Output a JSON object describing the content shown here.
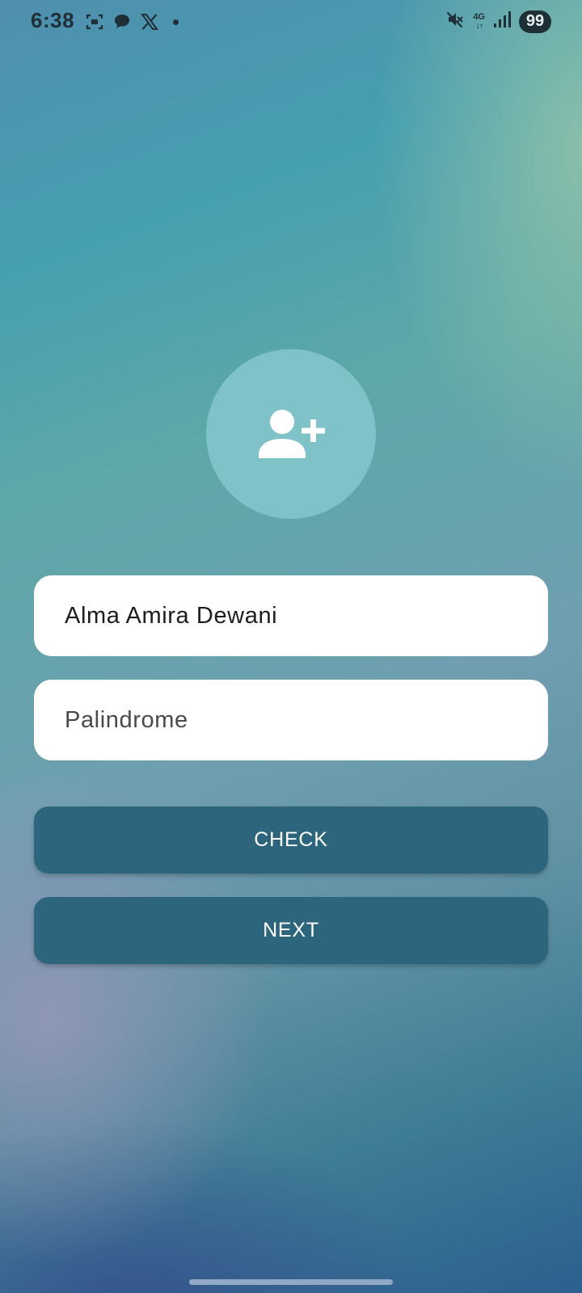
{
  "status_bar": {
    "time": "6:38",
    "left_icons": [
      "screenshot-icon",
      "chat-bubble-icon",
      "x-logo-icon",
      "notification-dot"
    ],
    "network_type": "4G",
    "network_arrows": "↓↑",
    "battery_level": "99",
    "right_icons": [
      "mute-icon",
      "network-4g-icon",
      "signal-icon",
      "battery-icon"
    ]
  },
  "avatar": {
    "icon": "add-person-icon",
    "background": "#7fc2c8"
  },
  "form": {
    "name_value": "Alma Amira Dewani",
    "palindrome_placeholder": "Palindrome",
    "palindrome_value": ""
  },
  "buttons": {
    "check_label": "CHECK",
    "next_label": "NEXT",
    "color": "#2d657d"
  }
}
